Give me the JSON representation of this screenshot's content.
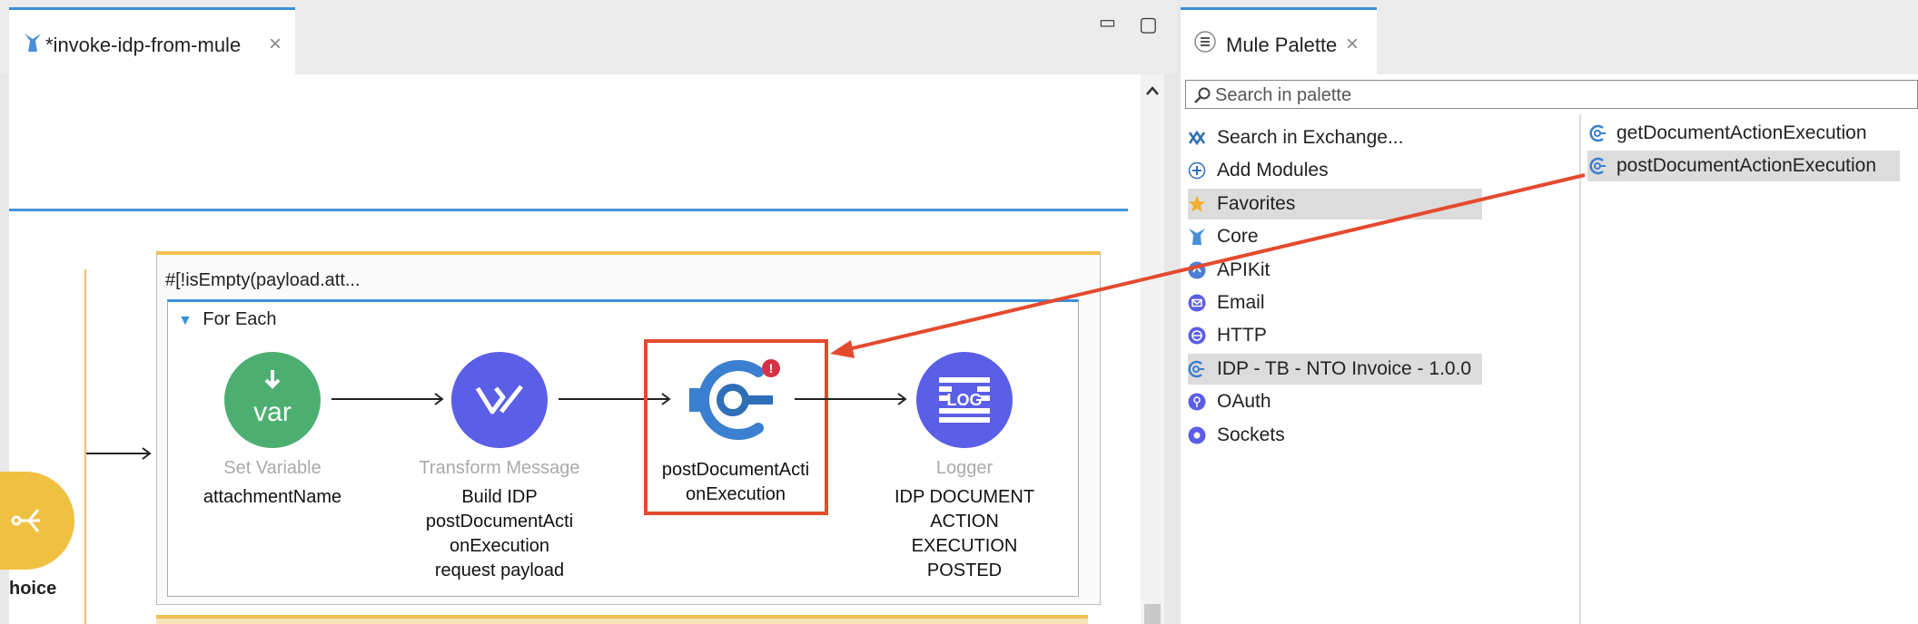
{
  "editor": {
    "tab_title": "*invoke-idp-from-mule",
    "tab_close": "×",
    "minimize_glyph": "▭",
    "maximize_glyph": "▢"
  },
  "flow": {
    "choice_label": "hoice",
    "condition": "#[!isEmpty(payload.att...",
    "foreach_title": "For Each",
    "foreach_glyph": "▼",
    "nodes": [
      {
        "type": "Set Variable",
        "name": "attachmentName",
        "icon_text": "var",
        "color": "#4caf70"
      },
      {
        "type": "Transform Message",
        "name": "Build IDP postDocumentActi onExecution request payload",
        "name_lines": [
          "Build IDP",
          "postDocumentActi",
          "onExecution",
          "request payload"
        ],
        "color": "#5b5ee6"
      },
      {
        "type": "",
        "name_lines": [
          "postDocumentActi",
          "onExecution"
        ],
        "color": "#3a7fd0",
        "error_badge": "!"
      },
      {
        "type": "Logger",
        "name_lines": [
          "IDP DOCUMENT",
          "ACTION",
          "EXECUTION",
          "POSTED"
        ],
        "icon_text": "LOG",
        "color": "#5b5ee6"
      }
    ]
  },
  "palette": {
    "tab_title": "Mule Palette",
    "tab_close": "×",
    "search_placeholder": "Search in palette",
    "items": [
      {
        "label": "Search in Exchange...",
        "icon": "exchange-icon"
      },
      {
        "label": "Add Modules",
        "icon": "plus-circle-icon"
      },
      {
        "label": "Favorites",
        "icon": "star-icon",
        "selected": true
      },
      {
        "label": "Core",
        "icon": "mule-icon"
      },
      {
        "label": "APIKit",
        "icon": "apikit-icon"
      },
      {
        "label": "Email",
        "icon": "email-icon"
      },
      {
        "label": "HTTP",
        "icon": "http-icon"
      },
      {
        "label": "IDP - TB - NTO Invoice - 1.0.0",
        "icon": "idp-icon",
        "selected": true
      },
      {
        "label": "OAuth",
        "icon": "oauth-icon"
      },
      {
        "label": "Sockets",
        "icon": "sockets-icon"
      }
    ],
    "operations": [
      {
        "label": "getDocumentActionExecution"
      },
      {
        "label": "postDocumentActionExecution",
        "selected": true
      }
    ]
  },
  "colors": {
    "accent_blue": "#3b8fdc",
    "highlight_red": "#e44a2e",
    "container_yellow": "#f0c050",
    "choice_yellow": "#f0c040"
  }
}
